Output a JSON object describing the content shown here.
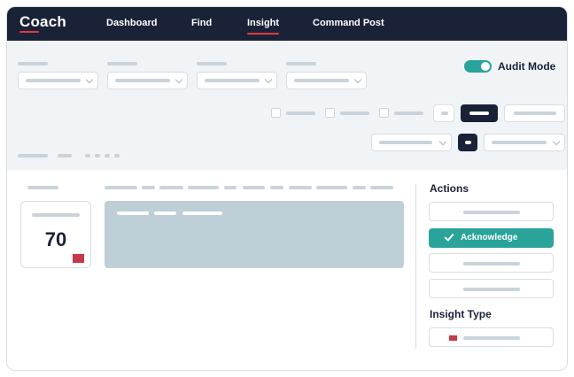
{
  "app": {
    "logo": "Coach"
  },
  "nav": {
    "items": [
      {
        "label": "Dashboard"
      },
      {
        "label": "Find"
      },
      {
        "label": "Insight",
        "active": true
      },
      {
        "label": "Command Post"
      }
    ]
  },
  "toolbar": {
    "audit_mode_label": "Audit Mode",
    "audit_mode_on": true
  },
  "score": {
    "value": "70"
  },
  "actions": {
    "title": "Actions",
    "acknowledge_label": "Acknowledge"
  },
  "insight_type": {
    "title": "Insight Type"
  },
  "colors": {
    "nav_bg": "#1a2238",
    "accent_teal": "#2aa39a",
    "flag_red": "#c7394b",
    "nav_underline": "#e23b3b"
  },
  "icons": {
    "toggle": "toggle-switch-icon",
    "acknowledge": "check-icon",
    "dropdown": "chevron-down-icon"
  }
}
